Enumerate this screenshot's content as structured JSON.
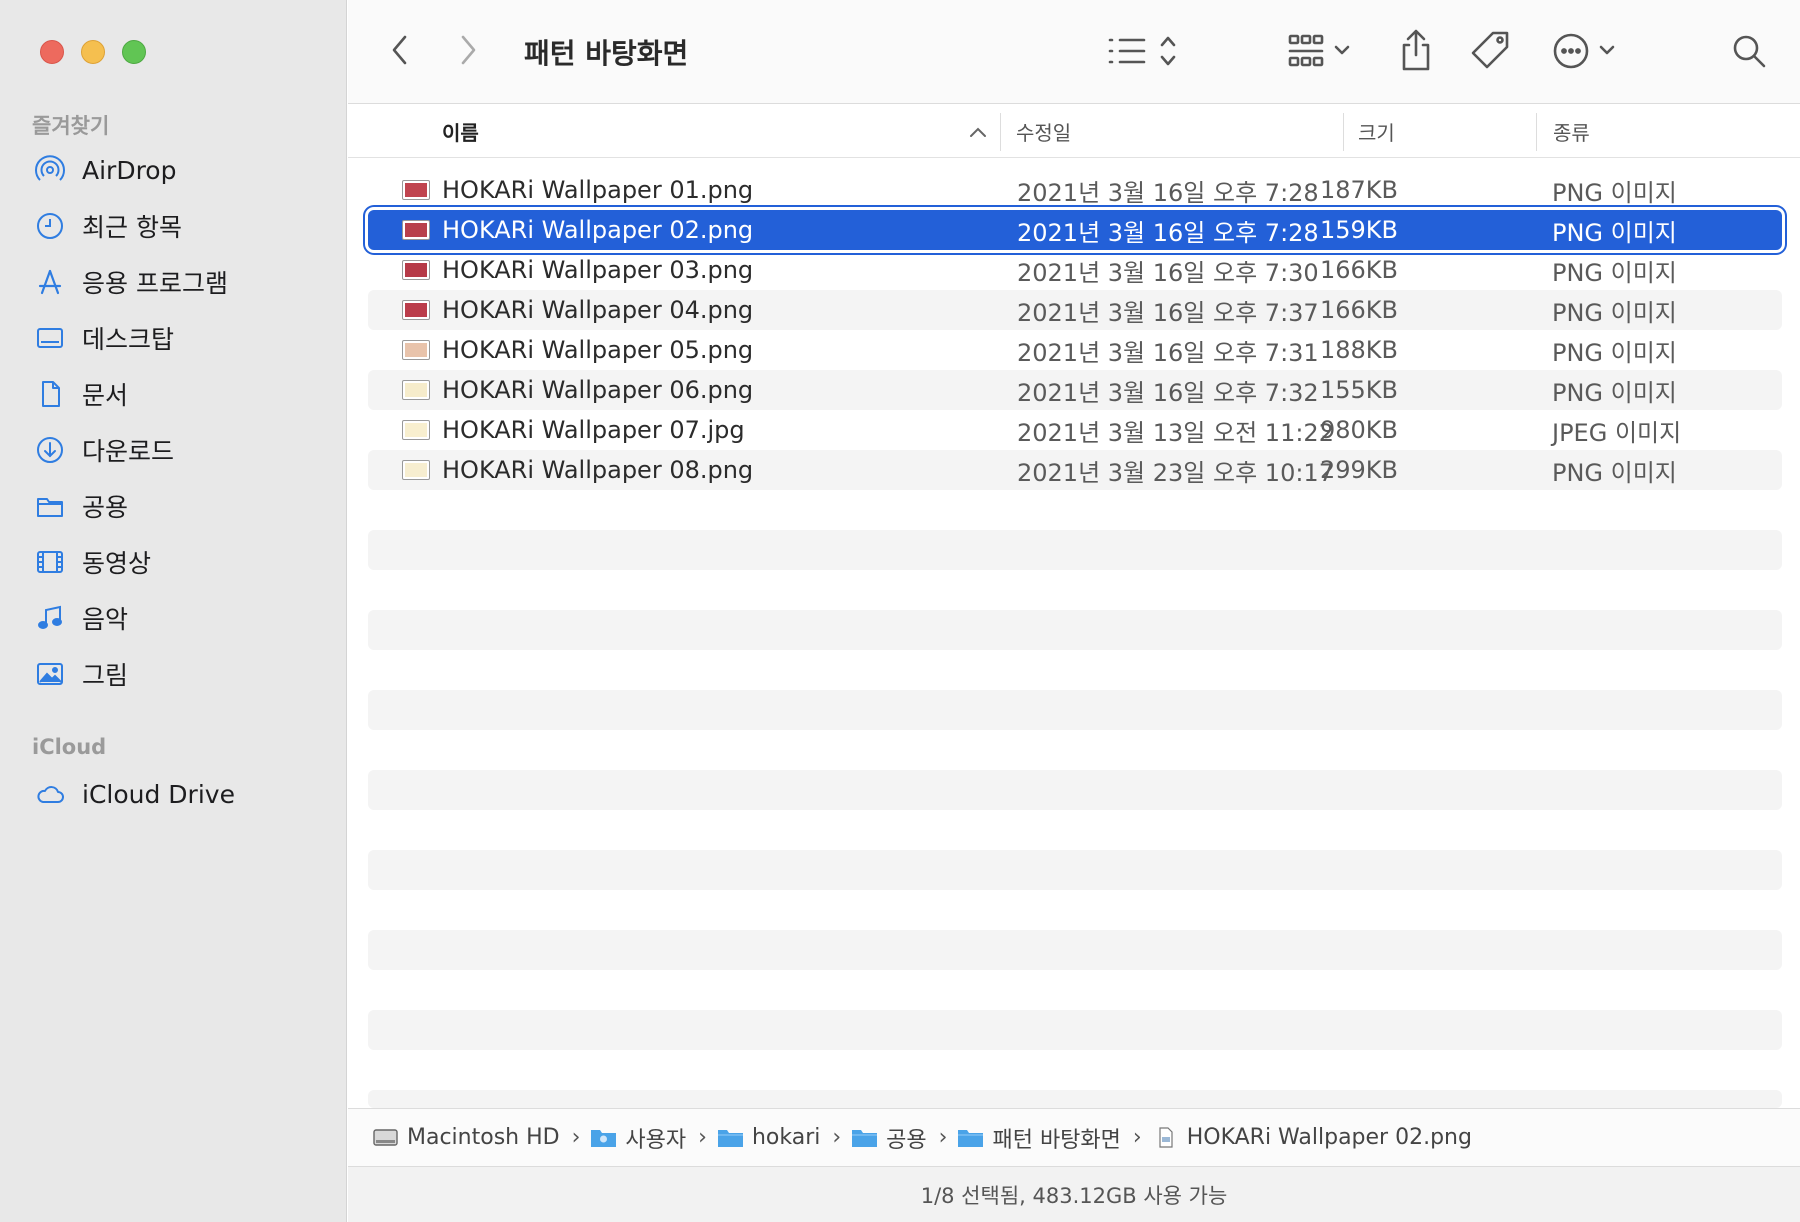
{
  "window": {
    "title": "패턴 바탕화면"
  },
  "sidebar": {
    "favorites_title": "즐겨찾기",
    "items": [
      {
        "label": "AirDrop",
        "icon": "airdrop-icon"
      },
      {
        "label": "최근 항목",
        "icon": "clock-icon"
      },
      {
        "label": "응용 프로그램",
        "icon": "applications-icon"
      },
      {
        "label": "데스크탑",
        "icon": "desktop-icon"
      },
      {
        "label": "문서",
        "icon": "document-icon"
      },
      {
        "label": "다운로드",
        "icon": "download-icon"
      },
      {
        "label": "공용",
        "icon": "folder-icon"
      },
      {
        "label": "동영상",
        "icon": "film-icon"
      },
      {
        "label": "음악",
        "icon": "music-icon"
      },
      {
        "label": "그림",
        "icon": "photo-icon"
      }
    ],
    "icloud_title": "iCloud",
    "icloud_items": [
      {
        "label": "iCloud Drive",
        "icon": "cloud-icon"
      }
    ]
  },
  "columns": {
    "name": "이름",
    "date": "수정일",
    "size": "크기",
    "kind": "종류"
  },
  "files": [
    {
      "name": "HOKARi Wallpaper 01.png",
      "date": "2021년 3월 16일 오후 7:28",
      "size": "187KB",
      "kind": "PNG 이미지",
      "swatch": "#c0444f",
      "selected": false
    },
    {
      "name": "HOKARi Wallpaper 02.png",
      "date": "2021년 3월 16일 오후 7:28",
      "size": "159KB",
      "kind": "PNG 이미지",
      "swatch": "#b8404c",
      "selected": true
    },
    {
      "name": "HOKARi Wallpaper 03.png",
      "date": "2021년 3월 16일 오후 7:30",
      "size": "166KB",
      "kind": "PNG 이미지",
      "swatch": "#b63a48",
      "selected": false
    },
    {
      "name": "HOKARi Wallpaper 04.png",
      "date": "2021년 3월 16일 오후 7:37",
      "size": "166KB",
      "kind": "PNG 이미지",
      "swatch": "#bb3d4b",
      "selected": false
    },
    {
      "name": "HOKARi Wallpaper 05.png",
      "date": "2021년 3월 16일 오후 7:31",
      "size": "188KB",
      "kind": "PNG 이미지",
      "swatch": "#e8c3ab",
      "selected": false
    },
    {
      "name": "HOKARi Wallpaper 06.png",
      "date": "2021년 3월 16일 오후 7:32",
      "size": "155KB",
      "kind": "PNG 이미지",
      "swatch": "#f6eccb",
      "selected": false
    },
    {
      "name": "HOKARi Wallpaper 07.jpg",
      "date": "2021년 3월 13일 오전 11:22",
      "size": "980KB",
      "kind": "JPEG 이미지",
      "swatch": "#f8efcf",
      "selected": false
    },
    {
      "name": "HOKARi Wallpaper 08.png",
      "date": "2021년 3월 23일 오후 10:17",
      "size": "299KB",
      "kind": "PNG 이미지",
      "swatch": "#f7eed0",
      "selected": false
    }
  ],
  "pathbar": [
    {
      "label": "Macintosh HD",
      "icon": "harddisk-icon"
    },
    {
      "label": "사용자",
      "icon": "users-folder-icon"
    },
    {
      "label": "hokari",
      "icon": "folder-icon"
    },
    {
      "label": "공용",
      "icon": "folder-icon"
    },
    {
      "label": "패턴 바탕화면",
      "icon": "folder-icon"
    },
    {
      "label": "HOKARi Wallpaper 02.png",
      "icon": "file-icon"
    }
  ],
  "status": "1/8 선택됨, 483.12GB 사용 가능",
  "colors": {
    "selection": "#2360d8",
    "sidebar_icon": "#2f7de1",
    "sidebar_bg": "#e8e8e8"
  }
}
